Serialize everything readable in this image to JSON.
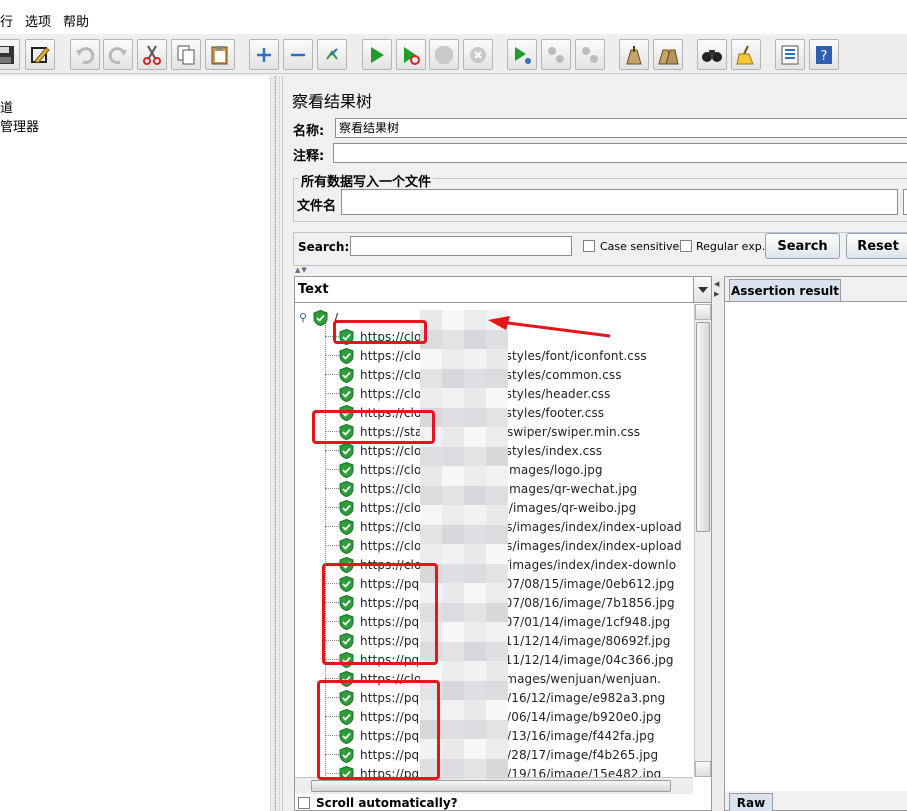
{
  "menubar": {
    "items": [
      "行",
      "选项",
      "帮助"
    ]
  },
  "toolbar": {
    "buttons": [
      "save-icon",
      "edit-icon",
      "undo-icon",
      "redo-icon",
      "cut-icon",
      "copy-icon",
      "paste-icon",
      "add-icon",
      "remove-icon",
      "toggle-icon",
      "start-icon",
      "start-no-pause-icon",
      "stop-icon",
      "shutdown-icon",
      "remote-start-icon",
      "remote-stop-icon",
      "remote-exit-icon",
      "clear-icon",
      "clear-all-icon",
      "search-binoculars-icon",
      "reset-search-broom-icon",
      "function-helper-icon",
      "help-icon"
    ]
  },
  "left_panel": {
    "items": [
      "道",
      "管理器"
    ]
  },
  "listener": {
    "title": "察看结果树",
    "name_label": "名称:",
    "name_value": "察看结果树",
    "comment_label": "注释:",
    "comment_value": "",
    "file_group_title": "所有数据写入一个文件",
    "filename_label": "文件名",
    "filename_value": ""
  },
  "search": {
    "label": "Search:",
    "query": "",
    "case_sensitive_label": "Case sensitive",
    "regex_label": "Regular exp.",
    "search_button": "Search",
    "reset_button": "Reset"
  },
  "results_tree": {
    "renderer_label": "Text",
    "root_label": "/",
    "items": [
      "https://cloud                      cn/",
      "https://cloud                      n/vendors/styles/font/iconfont.css",
      "https://cloud                      n/vendors/styles/common.css",
      "https://cloud                      n/vendors/styles/header.css",
      "https://cloud                      n/vendors/styles/footer.css",
      "https://stati                      n/lib/plugin/swiper/swiper.min.css",
      "https://cloud                      n/vendors/styles/index.css",
      "https://cloud                      n/vendors/images/logo.jpg",
      "https://cloud                      n/vendors/images/qr-wechat.jpg",
      "https://cloud.l                    n/vendors/images/qr-weibo.jpg",
      "https://cloud.k                    n/vendors/images/index/index-upload",
      "https://cloud.k                    n/vendors/images/index/index-upload",
      "https://cloud.k                    /vendors/images/index/index-downlo",
      "https://pqnoss                     cn/2020/07/08/15/image/0eb612.jpg",
      "https://pqnoss                     cn/2020/07/08/16/image/7b1856.jpg",
      "https://pqnoss                     cn/2020/07/01/14/image/1cf948.jpg",
      "https://pqnoss                     cn/2019/11/12/14/image/80692f.jpg",
      "https://pqnoss                     cn/2019/11/12/14/image/04c366.jpg",
      "https://cloud.                     /vendors/images/wenjuan/wenjuan.",
      "https://pqnos                      n/2020/06/16/12/image/e982a3.png",
      "https://pqnos                      n/2020/11/06/14/image/b920e0.jpg",
      "https://pqnos                      n/2020/07/13/16/image/f442fa.jpg",
      "https://pqnos                      n/2020/10/28/17/image/f4b265.jpg",
      "https://pqnos                      n/2020/10/19/16/image/15e482.jpg"
    ],
    "scroll_auto_label": "Scroll automatically?"
  },
  "result_tabs": {
    "assertion_tab": "Assertion result",
    "raw_tab": "Raw"
  },
  "colors": {
    "annotation": "#e8141b",
    "shield": "#2e9e3a",
    "button_border": "#8fa3bd"
  }
}
